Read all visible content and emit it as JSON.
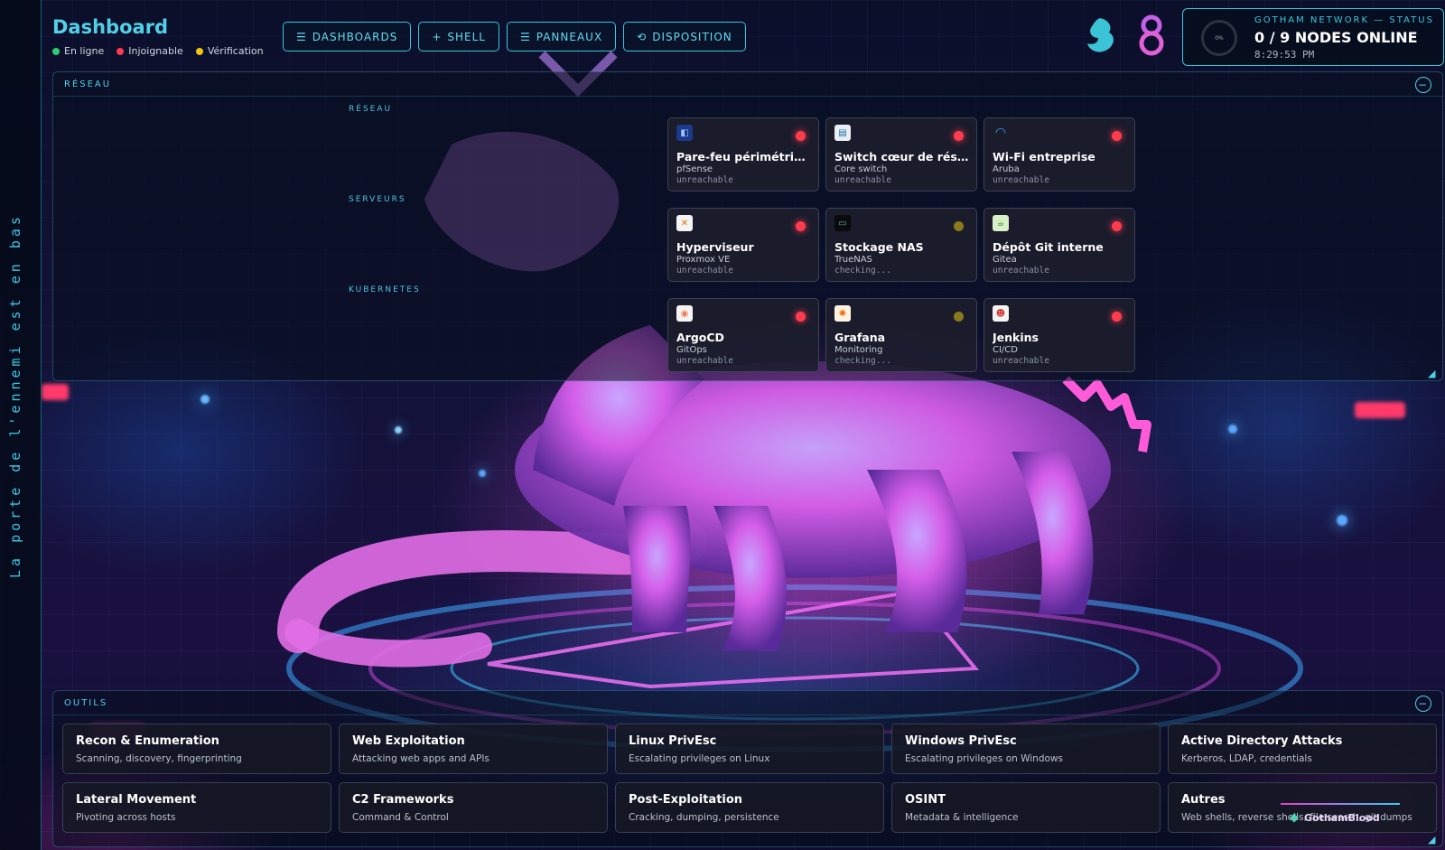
{
  "sidebar": {
    "vertical_text": "La porte de l'ennemi est en bas"
  },
  "header": {
    "title": "Dashboard",
    "legend": [
      {
        "label": "En ligne",
        "color": "#2ecc71"
      },
      {
        "label": "Injoignable",
        "color": "#ff3b4e"
      },
      {
        "label": "Vérification",
        "color": "#f1c40f"
      }
    ],
    "nav": [
      {
        "icon": "☰",
        "label": "DASHBOARDS"
      },
      {
        "icon": "+",
        "label": "SHELL"
      },
      {
        "icon": "☰",
        "label": "PANNEAUX"
      },
      {
        "icon": "⟲",
        "label": "DISPOSITION"
      }
    ]
  },
  "status": {
    "label": "GOTHAM NETWORK — STATUS",
    "summary": "0 / 9 NODES ONLINE",
    "time": "8:29:53 PM",
    "ring_text": "0%",
    "ring_percent": 0
  },
  "network_panel": {
    "title": "RÉSEAU",
    "groups": [
      {
        "label": "RÉSEAU",
        "cards": [
          {
            "name": "Pare-feu périmétrique",
            "sub": "pfSense",
            "state": "unreachable",
            "state_color": "#ff3b4e",
            "icon": "shield-icon"
          },
          {
            "name": "Switch cœur de rése...",
            "sub": "Core switch",
            "state": "unreachable",
            "state_color": "#ff3b4e",
            "icon": "switch-icon"
          },
          {
            "name": "Wi-Fi entreprise",
            "sub": "Aruba",
            "state": "unreachable",
            "state_color": "#ff3b4e",
            "icon": "wifi-icon"
          }
        ]
      },
      {
        "label": "SERVEURS",
        "cards": [
          {
            "name": "Hyperviseur",
            "sub": "Proxmox VE",
            "state": "unreachable",
            "state_color": "#ff3b4e",
            "icon": "proxmox-icon"
          },
          {
            "name": "Stockage NAS",
            "sub": "TrueNAS",
            "state": "checking...",
            "state_color": "#8a7a1a",
            "icon": "nas-icon"
          },
          {
            "name": "Dépôt Git interne",
            "sub": "Gitea",
            "state": "unreachable",
            "state_color": "#ff3b4e",
            "icon": "gitea-icon"
          }
        ]
      },
      {
        "label": "KUBERNETES",
        "cards": [
          {
            "name": "ArgoCD",
            "sub": "GitOps",
            "state": "unreachable",
            "state_color": "#ff3b4e",
            "icon": "argocd-icon"
          },
          {
            "name": "Grafana",
            "sub": "Monitoring",
            "state": "checking...",
            "state_color": "#8a7a1a",
            "icon": "grafana-icon"
          },
          {
            "name": "Jenkins",
            "sub": "CI/CD",
            "state": "unreachable",
            "state_color": "#ff3b4e",
            "icon": "jenkins-icon"
          }
        ]
      }
    ]
  },
  "tools_panel": {
    "title": "OUTILS",
    "items": [
      {
        "name": "Recon & Enumeration",
        "desc": "Scanning, discovery, fingerprinting"
      },
      {
        "name": "Web Exploitation",
        "desc": "Attacking web apps and APIs"
      },
      {
        "name": "Linux PrivEsc",
        "desc": "Escalating privileges on Linux"
      },
      {
        "name": "Windows PrivEsc",
        "desc": "Escalating privileges on Windows"
      },
      {
        "name": "Active Directory Attacks",
        "desc": "Kerberos, LDAP, credentials"
      },
      {
        "name": "Lateral Movement",
        "desc": "Pivoting across hosts"
      },
      {
        "name": "C2 Frameworks",
        "desc": "Command & Control"
      },
      {
        "name": "Post-Exploitation",
        "desc": "Cracking, dumping, persistence"
      },
      {
        "name": "OSINT",
        "desc": "Metadata & intelligence"
      },
      {
        "name": "Autres",
        "desc": "Web shells, reverse shells, file search, git dumps"
      }
    ]
  },
  "watermark": {
    "text": "GothamBlood"
  }
}
